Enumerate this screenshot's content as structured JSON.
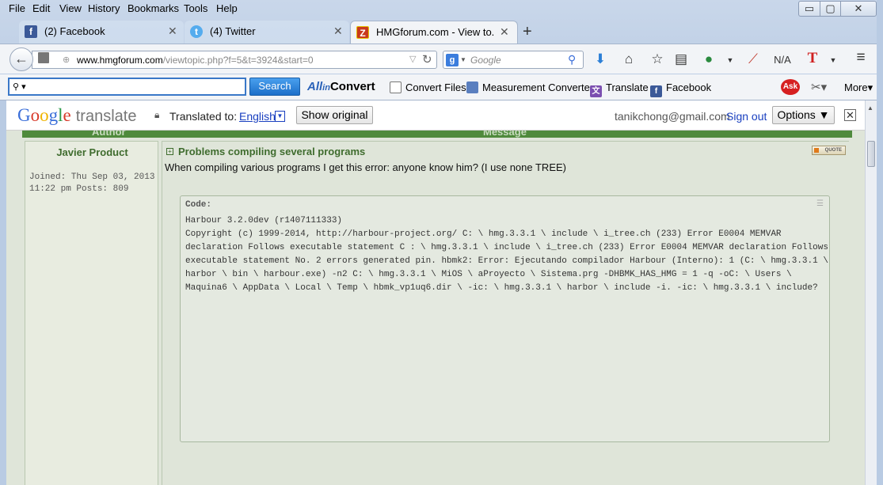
{
  "menubar": {
    "items": [
      "File",
      "Edit",
      "View",
      "History",
      "Bookmarks",
      "Tools",
      "Help"
    ]
  },
  "window_controls": {
    "minimize": "▭",
    "maximize": "▢",
    "close": "✕"
  },
  "tabs": [
    {
      "title": "(2) Facebook",
      "icon": "facebook-icon",
      "active": false
    },
    {
      "title": "(4) Twitter",
      "icon": "twitter-icon",
      "active": false
    },
    {
      "title": "HMGforum.com - View to...",
      "icon": "hmgforum-icon",
      "active": true
    }
  ],
  "navbar": {
    "url_domain": "www.hmgforum.com",
    "url_path": "/viewtopic.php?f=5&t=3924&start=0",
    "search_placeholder": "Google",
    "na_label": "N/A"
  },
  "ext_toolbar": {
    "search_value": "",
    "search_button": "Search",
    "allinconvert_label": "Convert",
    "items": [
      "Convert Files",
      "Measurement Converter",
      "Translate",
      "Facebook"
    ],
    "more_label": "More"
  },
  "translate_bar": {
    "logo_google": "Google",
    "logo_translate": "translate",
    "translated_to_label": "Translated to:",
    "language": "English",
    "show_original_button": "Show original",
    "email": "tanikchong@gmail.com",
    "sign_out": "Sign out",
    "options_button": "Options ▼"
  },
  "forum": {
    "col_author": "Author",
    "col_message": "Message",
    "author_name": "Javier Product",
    "author_joined": "Joined: Thu Sep 03, 2013 11:22 pm Posts: 809",
    "post_title": "Problems compiling several programs",
    "quote_button": "QUOTE",
    "post_body": "When compiling various programs I get this error: anyone know him? (I use none TREE)",
    "code_label": "Code:",
    "code_text": "Harbour 3.2.0dev (r1407111333)\nCopyright (c) 1999-2014, http://harbour-project.org/ C: \\ hmg.3.3.1 \\ include \\ i_tree.ch (233) Error E0004 MEMVAR declaration Follows executable statement C : \\ hmg.3.3.1 \\ include \\ i_tree.ch (233) Error E0004 MEMVAR declaration Follows executable statement No. 2 errors generated pin. hbmk2: Error: Ejecutando compilador Harbour (Interno): 1 (C: \\ hmg.3.3.1 \\ harbor \\ bin \\ harbour.exe) -n2 C: \\ hmg.3.3.1 \\ MiOS \\ aProyecto \\ Sistema.prg -DHBMK_HAS_HMG = 1 -q -oC: \\ Users \\ Maquina6 \\ AppData \\ Local \\ Temp \\ hbmk_vp1uq6.dir \\ -ic: \\ hmg.3.3.1 \\ harbor \\ include -i. -ic: \\ hmg.3.3.1 \\ include?"
  }
}
